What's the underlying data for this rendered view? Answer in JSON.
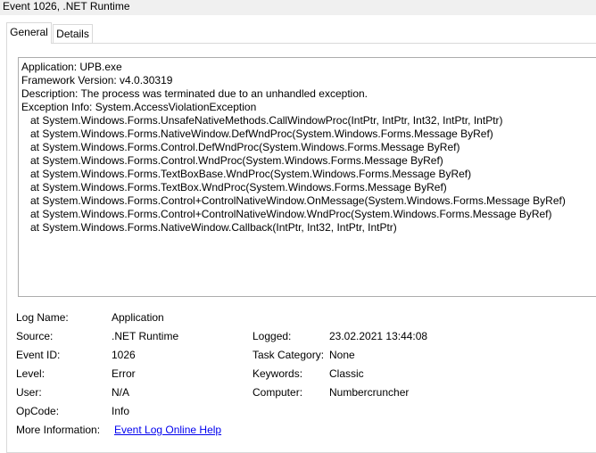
{
  "window": {
    "title": "Event 1026, .NET Runtime"
  },
  "tabs": [
    {
      "label": "General"
    },
    {
      "label": "Details"
    }
  ],
  "description_lines": [
    "Application: UPB.exe",
    "Framework Version: v4.0.30319",
    "Description: The process was terminated due to an unhandled exception.",
    "Exception Info: System.AccessViolationException",
    "   at System.Windows.Forms.UnsafeNativeMethods.CallWindowProc(IntPtr, IntPtr, Int32, IntPtr, IntPtr)",
    "   at System.Windows.Forms.NativeWindow.DefWndProc(System.Windows.Forms.Message ByRef)",
    "   at System.Windows.Forms.Control.DefWndProc(System.Windows.Forms.Message ByRef)",
    "   at System.Windows.Forms.Control.WndProc(System.Windows.Forms.Message ByRef)",
    "   at System.Windows.Forms.TextBoxBase.WndProc(System.Windows.Forms.Message ByRef)",
    "   at System.Windows.Forms.TextBox.WndProc(System.Windows.Forms.Message ByRef)",
    "   at System.Windows.Forms.Control+ControlNativeWindow.OnMessage(System.Windows.Forms.Message ByRef)",
    "   at System.Windows.Forms.Control+ControlNativeWindow.WndProc(System.Windows.Forms.Message ByRef)",
    "   at System.Windows.Forms.NativeWindow.Callback(IntPtr, Int32, IntPtr, IntPtr)"
  ],
  "fields": {
    "log_name": {
      "label": "Log Name:",
      "value": "Application"
    },
    "source": {
      "label": "Source:",
      "value": ".NET Runtime"
    },
    "logged": {
      "label": "Logged:",
      "value": "23.02.2021 13:44:08"
    },
    "event_id": {
      "label": "Event ID:",
      "value": "1026"
    },
    "task_category": {
      "label": "Task Category:",
      "value": "None"
    },
    "level": {
      "label": "Level:",
      "value": "Error"
    },
    "keywords": {
      "label": "Keywords:",
      "value": "Classic"
    },
    "user": {
      "label": "User:",
      "value": "N/A"
    },
    "computer": {
      "label": "Computer:",
      "value": "Numbercruncher"
    },
    "opcode": {
      "label": "OpCode:",
      "value": "Info"
    },
    "more_info": {
      "label": "More Information:",
      "value": "Event Log Online Help"
    }
  }
}
